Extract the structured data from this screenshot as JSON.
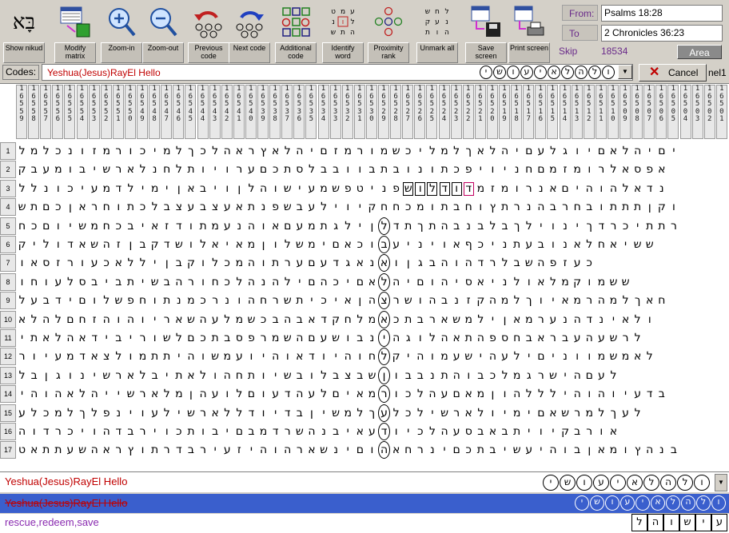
{
  "toolbar": {
    "buttons": [
      {
        "label": "Show nikud"
      },
      {
        "label": "Modify matrix"
      },
      {
        "label": "Zoom-in"
      },
      {
        "label": "Zoom-out"
      },
      {
        "label": "Previous code"
      },
      {
        "label": "Next code"
      },
      {
        "label": "Additional code"
      },
      {
        "label": "Identify word"
      },
      {
        "label": "Proximity rank"
      },
      {
        "label": "Unmark all"
      },
      {
        "label": "Save screen"
      },
      {
        "label": "Print screen"
      }
    ]
  },
  "range": {
    "from_label": "From:",
    "from_value": "Psalms 18:28",
    "to_label": "To",
    "to_value": "2 Chronicles 36:23",
    "skip_label": "Skip",
    "skip_value": "18534",
    "area_label": "Area"
  },
  "codes": {
    "label": "Codes:",
    "value": "Yeshua(Jesus)RayEl Hello",
    "circled_letters": [
      "י",
      "ש",
      "ו",
      "ע",
      "י",
      "א",
      "ל",
      "ה",
      "ל",
      "ו"
    ],
    "cancel_label": "Cancel",
    "panel_label": "nel1"
  },
  "matrix": {
    "column_headers": [
      "1\n6\n5\n5\n9",
      "1\n6\n5\n5\n8",
      "1\n6\n5\n5\n7",
      "1\n6\n5\n5\n6",
      "1\n6\n5\n5\n5",
      "1\n6\n5\n5\n4",
      "1\n6\n5\n5\n3",
      "1\n6\n5\n5\n2",
      "1\n6\n5\n5\n1",
      "1\n6\n5\n5\n0",
      "1\n6\n5\n4\n9",
      "1\n6\n5\n4\n8",
      "1\n6\n5\n4\n7",
      "1\n6\n5\n4\n6",
      "1\n6\n5\n4\n5",
      "1\n6\n5\n4\n4",
      "1\n6\n5\n4\n3",
      "1\n6\n5\n4\n2",
      "1\n6\n5\n4\n1",
      "1\n6\n5\n4\n0",
      "1\n6\n5\n3\n9",
      "1\n6\n5\n3\n8",
      "1\n6\n5\n3\n7",
      "1\n6\n5\n3\n6",
      "1\n6\n5\n3\n5",
      "1\n6\n5\n3\n4",
      "1\n6\n5\n3\n3",
      "1\n6\n5\n3\n2",
      "1\n6\n5\n3\n1",
      "1\n6\n5\n3\n0",
      "1\n6\n5\n2\n9",
      "1\n6\n5\n2\n8",
      "1\n6\n5\n2\n7",
      "1\n6\n5\n2\n6",
      "1\n6\n5\n2\n5",
      "1\n6\n5\n2\n4",
      "1\n6\n5\n2\n3",
      "1\n6\n5\n2\n2",
      "1\n6\n5\n2\n1",
      "1\n6\n5\n2\n0",
      "1\n6\n5\n1\n9",
      "1\n6\n5\n1\n8",
      "1\n6\n5\n1\n7",
      "1\n6\n5\n1\n6",
      "1\n6\n5\n1\n5",
      "1\n6\n5\n1\n4",
      "1\n6\n5\n1\n3",
      "1\n6\n5\n1\n2",
      "1\n6\n5\n1\n1",
      "1\n6\n5\n1\n0",
      "1\n6\n5\n0\n9",
      "1\n6\n5\n0\n8",
      "1\n6\n5\n0\n7",
      "1\n6\n5\n0\n6",
      "1\n6\n5\n0\n5",
      "1\n6\n5\n0\n4",
      "1\n6\n5\n0\n3",
      "1\n6\n5\n0\n2",
      "1\n6\n5\n0\n1"
    ],
    "row_numbers": [
      "1",
      "2",
      "3",
      "4",
      "5",
      "6",
      "7",
      "8",
      "9",
      "10",
      "11",
      "12",
      "13",
      "14",
      "15",
      "16",
      "17"
    ],
    "rows": [
      "למלכנוזמרוכימלךכלהארץאלהיםזמרומשכילמלךאלהיםעלגויםאלהיםי",
      "קבעמובישראלנחלתויורעםכתסלבבוובתבונותכפיוינחםמזמורלאספא",
      "ללנוכיעמדלימיןאביוןלהושיעמשפטינפשולדודמזמורנאםיהוהלאדנ",
      "שתםכןארחותכלבצעבצעאתנפשבעליויקחחכמותבחוץתרנהברחבותתתןקו",
      "חכםוישמחכביאזדותמענהואםעמתגליןלדתךתהבנבלבךליוניךדרכיתתר",
      "קילודאשהזןבקדשולאיאמןולשמיםאכובעיניואףכינתעבונאלחאישש",
      "ואסזרועכאלליןבקולכמהותרעםעדגאנאוןגבהוהדרלבשהפזעכ",
      "וחועלסביבתישבהרוחכלהנהליםהכיםאלהיםוהיסאינלואלמקומשש",
      "לעבדיםולשפחותנמכרנוהחרשתיכיאןהצרשוהבנזקהמלךויאמרהמלךאח",
      "אלהלםחזהוהויראשהעלמשכבהבאדקחלמאכתבראשמליןאמרענהדניאלו",
      "יתאלהאדיבירושלםכתבספרמשהםעשובניהגולהאתהפסחבארבעהעשרל",
      "רויעמדאצלומתתיהושמעויהואדויהוחלקיהומעשיהעליםינוומשמאל",
      "לבןגונישראלביתאלוהחתוישבולבצבשןובבנתהובכלמגרשיהםעל",
      "יהוהאלהיישראלמןהעולםועדהעלםיאמרוכלהעםאמןוהללליהוהויעדב",
      "עלכמלךלפניועלישראללדוידבןישמלךעלכלישראלוימיםאשרמלךעל",
      "הודרכיוהדבריוכתוביםבמדרשהנביאעדויכלהעסבאבתיויקברוא",
      "טאתתעשהארץותרדבריעזיהוהראשניםוהאחרניםכתבישעיהובןאמוץהנב"
    ]
  },
  "output": {
    "line1": "Yeshua(Jesus)RayEl Hello",
    "line1_letters": [
      "י",
      "ש",
      "ו",
      "ע",
      "י",
      "א",
      "ל",
      "ה",
      "ל",
      "ו"
    ],
    "line2": "Yeshua(Jesus)RayEl Hello",
    "line2_letters": [
      "י",
      "ש",
      "ו",
      "ע",
      "י",
      "א",
      "ל",
      "ה",
      "ל",
      "ו"
    ],
    "line3": "rescue,redeem,save",
    "line3_letters": [
      "ל",
      "ה",
      "ו",
      "ש",
      "י",
      "ע"
    ]
  },
  "colors": {
    "accent_red": "#c00000",
    "purple": "#6a2b8a",
    "highlight_blue": "#3a5fcd"
  }
}
